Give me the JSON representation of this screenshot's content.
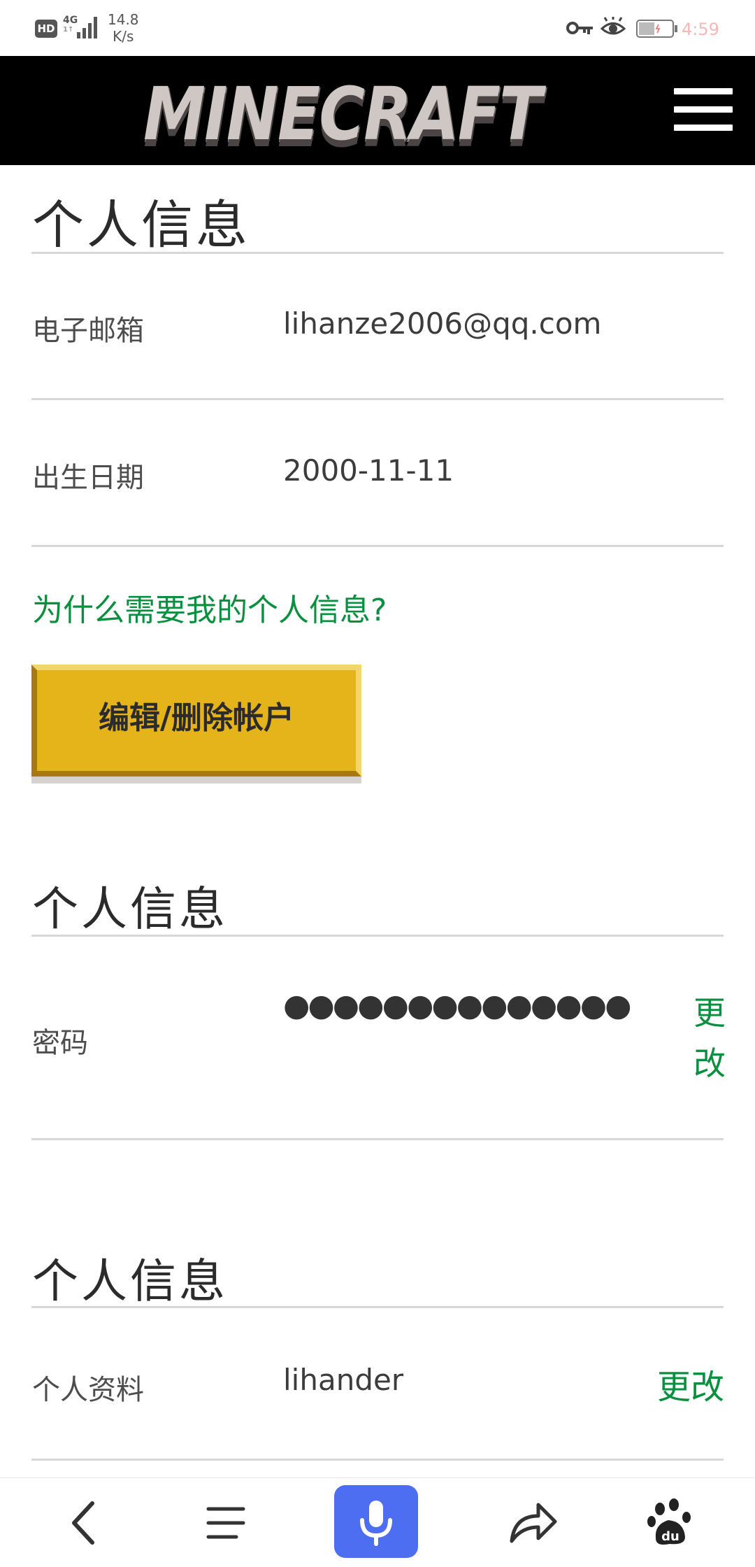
{
  "status_bar": {
    "hd": "HD",
    "network": "4G",
    "network_sub": "1↑",
    "speed_value": "14.8",
    "speed_unit": "K/s",
    "time": "4:59"
  },
  "header": {
    "logo_text": "MINECRAFT",
    "menu_icon": "hamburger-menu-icon"
  },
  "section_personal": {
    "title": "个人信息",
    "email_label": "电子邮箱",
    "email_value": "lihanze2006@qq.com",
    "birth_label": "出生日期",
    "birth_value": "2000-11-11",
    "why_link": "为什么需要我的个人信息?",
    "edit_button": "编辑/删除帐户"
  },
  "section_password": {
    "title": "个人信息",
    "password_label": "密码",
    "password_mask": "●●●●●●●●●●●●●●",
    "change_label": "更改"
  },
  "section_profile": {
    "title": "个人信息",
    "profile_label": "个人资料",
    "profile_value": "lihander",
    "change_label": "更改"
  },
  "bottom_nav": {
    "back_icon": "back-arrow-icon",
    "menu_icon": "list-menu-icon",
    "voice_icon": "microphone-icon",
    "share_icon": "share-arrow-icon",
    "home_icon": "baidu-paw-icon",
    "home_label": "du"
  },
  "colors": {
    "header_bg": "#000000",
    "accent_green": "#0a8f3e",
    "button_gold": "#e5b41a",
    "mic_blue": "#4e6ef2"
  }
}
